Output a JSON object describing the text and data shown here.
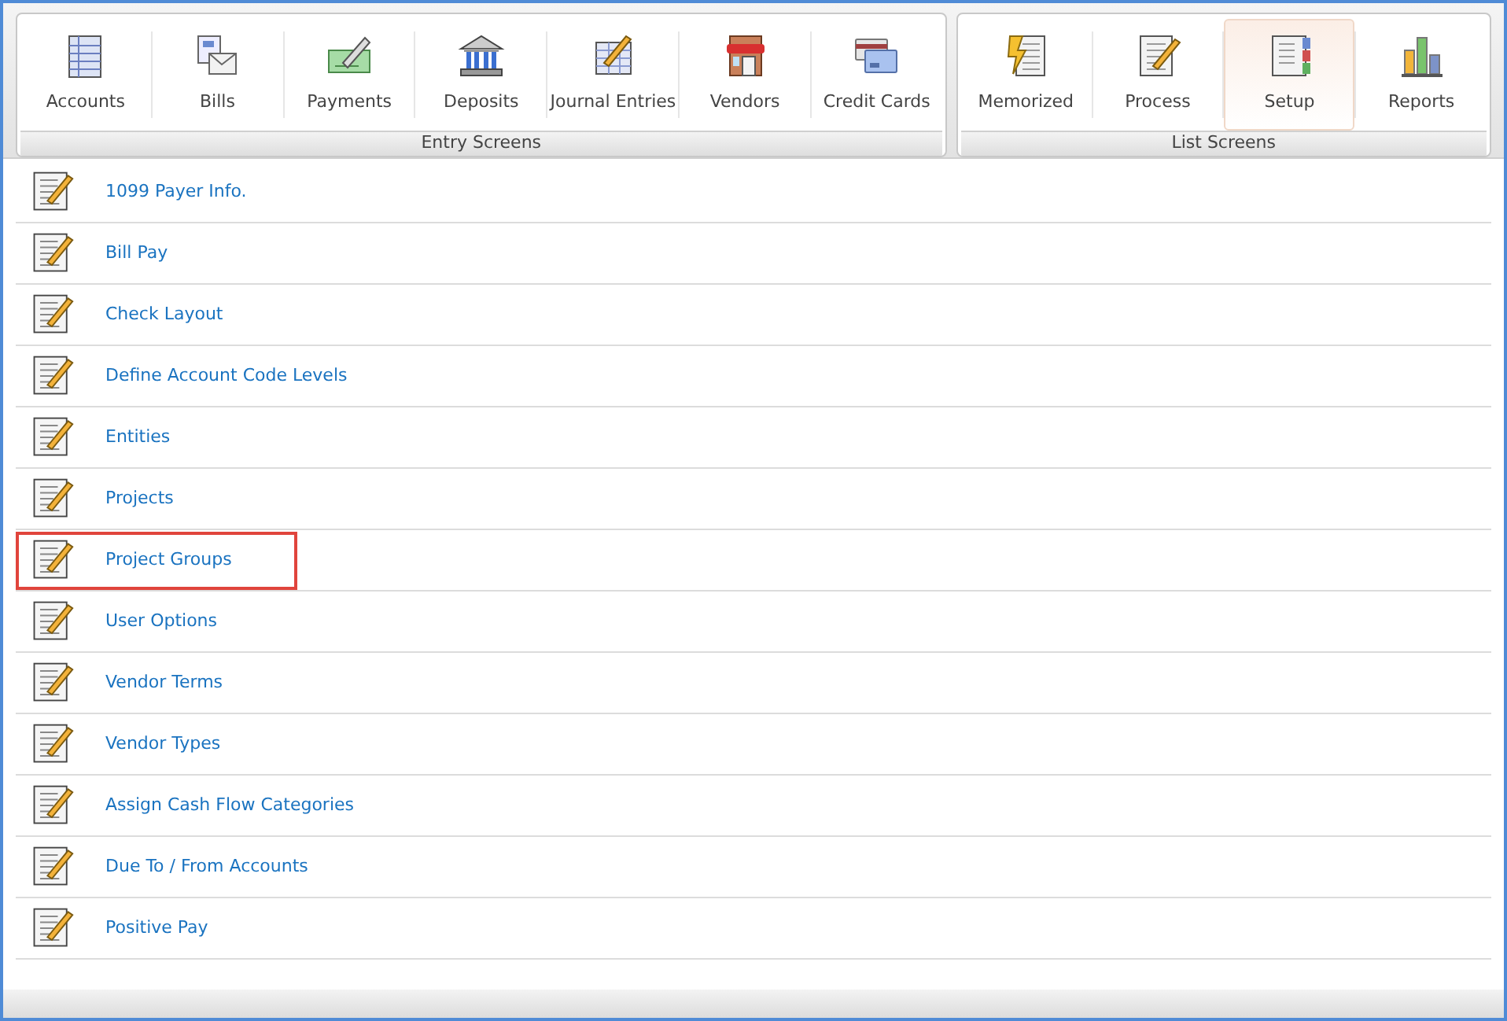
{
  "toolbar_groups": [
    {
      "label": "Entry Screens",
      "buttons": [
        {
          "label": "Accounts",
          "kind": "ledger",
          "selected": false
        },
        {
          "label": "Bills",
          "kind": "envelope",
          "selected": false
        },
        {
          "label": "Payments",
          "kind": "check",
          "selected": false
        },
        {
          "label": "Deposits",
          "kind": "bank",
          "selected": false
        },
        {
          "label": "Journal Entries",
          "kind": "journal",
          "selected": false
        },
        {
          "label": "Vendors",
          "kind": "store",
          "selected": false
        },
        {
          "label": "Credit Cards",
          "kind": "cards",
          "selected": false
        }
      ]
    },
    {
      "label": "List Screens",
      "buttons": [
        {
          "label": "Memorized",
          "kind": "bolt",
          "selected": false
        },
        {
          "label": "Process",
          "kind": "pad",
          "selected": false
        },
        {
          "label": "Setup",
          "kind": "binder",
          "selected": true
        },
        {
          "label": "Reports",
          "kind": "bars",
          "selected": false
        }
      ]
    }
  ],
  "items": [
    {
      "label": "1099 Payer Info.",
      "highlighted": false
    },
    {
      "label": "Bill Pay",
      "highlighted": false
    },
    {
      "label": "Check Layout",
      "highlighted": false
    },
    {
      "label": "Define Account Code Levels",
      "highlighted": false
    },
    {
      "label": "Entities",
      "highlighted": false
    },
    {
      "label": "Projects",
      "highlighted": false
    },
    {
      "label": "Project Groups",
      "highlighted": true
    },
    {
      "label": "User Options",
      "highlighted": false
    },
    {
      "label": "Vendor Terms",
      "highlighted": false
    },
    {
      "label": "Vendor Types",
      "highlighted": false
    },
    {
      "label": "Assign Cash Flow Categories",
      "highlighted": false
    },
    {
      "label": "Due To / From Accounts",
      "highlighted": false
    },
    {
      "label": "Positive Pay",
      "highlighted": false
    }
  ]
}
